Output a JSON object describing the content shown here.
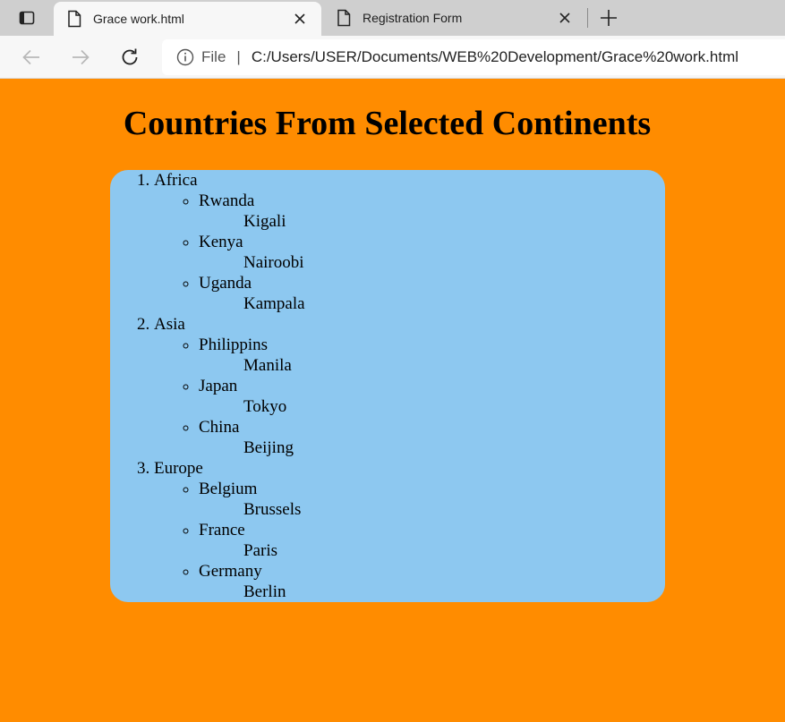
{
  "browser": {
    "tabs": [
      {
        "title": "Grace work.html",
        "active": true
      },
      {
        "title": "Registration Form",
        "active": false
      }
    ],
    "address": {
      "scheme": "File",
      "url": "C:/Users/USER/Documents/WEB%20Development/Grace%20work.html"
    }
  },
  "page": {
    "heading": "Countries From Selected Continents",
    "background_color": "#ff8c00",
    "box_color": "#8dc8f0",
    "continents": [
      {
        "name": "Africa",
        "countries": [
          {
            "name": "Rwanda",
            "capital": "Kigali"
          },
          {
            "name": "Kenya",
            "capital": "Nairoobi"
          },
          {
            "name": "Uganda",
            "capital": "Kampala"
          }
        ]
      },
      {
        "name": "Asia",
        "countries": [
          {
            "name": "Philippins",
            "capital": "Manila"
          },
          {
            "name": "Japan",
            "capital": "Tokyo"
          },
          {
            "name": "China",
            "capital": "Beijing"
          }
        ]
      },
      {
        "name": "Europe",
        "countries": [
          {
            "name": "Belgium",
            "capital": "Brussels"
          },
          {
            "name": "France",
            "capital": "Paris"
          },
          {
            "name": "Germany",
            "capital": "Berlin"
          }
        ]
      }
    ]
  }
}
